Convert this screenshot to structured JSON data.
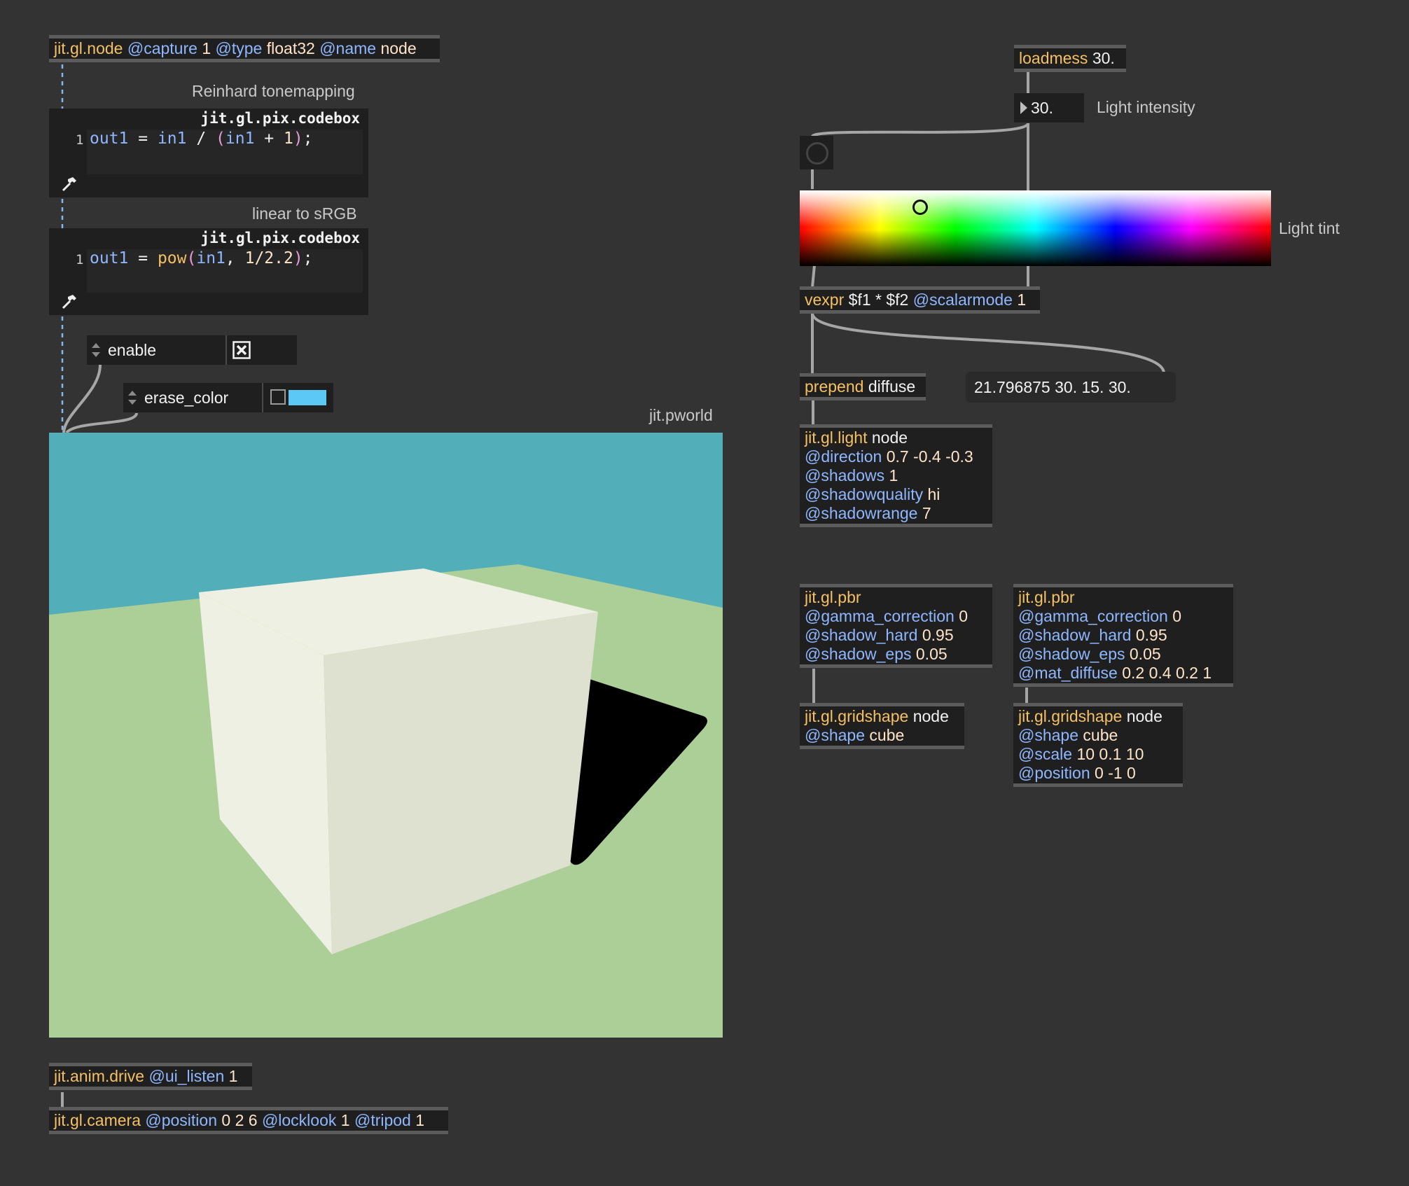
{
  "objects": {
    "gl_node": {
      "cls": "jit.gl.node",
      "a1": "@capture",
      "v1": "1",
      "a2": "@type",
      "v2": "float32",
      "a3": "@name",
      "v3": "node"
    },
    "anim_drive": {
      "cls": "jit.anim.drive",
      "a1": "@ui_listen",
      "v1": "1"
    },
    "camera": {
      "cls": "jit.gl.camera",
      "a1": "@position",
      "v1": "0 2 6",
      "a2": "@locklook",
      "v2": "1",
      "a3": "@tripod",
      "v3": "1"
    },
    "loadmess": {
      "cls": "loadmess",
      "v1": "30."
    },
    "vexpr": {
      "cls": "vexpr",
      "v1": "$f1 * $f2",
      "a1": "@scalarmode",
      "v2": "1"
    },
    "prepend": {
      "cls": "prepend",
      "v1": "diffuse"
    },
    "light": {
      "cls": "jit.gl.light",
      "v0": "node",
      "a1": "@direction",
      "v1": "0.7 -0.4 -0.3",
      "a2": "@shadows",
      "v2": "1",
      "a3": "@shadowquality",
      "v3": "hi",
      "a4": "@shadowrange",
      "v4": "7"
    },
    "pbr1": {
      "cls": "jit.gl.pbr",
      "a1": "@gamma_correction",
      "v1": "0",
      "a2": "@shadow_hard",
      "v2": "0.95",
      "a3": "@shadow_eps",
      "v3": "0.05"
    },
    "pbr2": {
      "cls": "jit.gl.pbr",
      "a1": "@gamma_correction",
      "v1": "0",
      "a2": "@shadow_hard",
      "v2": "0.95",
      "a3": "@shadow_eps",
      "v3": "0.05",
      "a4": "@mat_diffuse",
      "v4": "0.2 0.4 0.2 1"
    },
    "grid1": {
      "cls": "jit.gl.gridshape",
      "v0": "node",
      "a1": "@shape",
      "v1": "cube"
    },
    "grid2": {
      "cls": "jit.gl.gridshape",
      "v0": "node",
      "a1": "@shape",
      "v1": "cube",
      "a2": "@scale",
      "v2": "10 0.1 10",
      "a3": "@position",
      "v3": "0 -1 0"
    }
  },
  "codeboxes": {
    "tonemap": {
      "comment": "Reinhard tonemapping",
      "title": "jit.gl.pix.codebox",
      "line": "1",
      "t1": "out1",
      "t2": " = ",
      "t3": "in1",
      "t4": " / ",
      "t5": "(",
      "t6": "in1",
      "t7": " + ",
      "t8": "1",
      "t9": ")",
      "t10": ";"
    },
    "srgb": {
      "comment": "linear to sRGB",
      "title": "jit.gl.pix.codebox",
      "line": "1",
      "t1": "out1",
      "t2": " = ",
      "t3": "pow",
      "t4": "(",
      "t5": "in1",
      "t6": ", ",
      "t7": "1/2.2",
      "t8": ")",
      "t9": ";"
    }
  },
  "ui": {
    "enable": {
      "label": "enable",
      "checked": true
    },
    "erase_color": {
      "label": "erase_color",
      "swatch": "#5bc8f5"
    },
    "pworld_label": "jit.pworld",
    "intensity": {
      "value": "30.",
      "label": "Light intensity"
    },
    "tint_label": "Light tint",
    "message": "21.796875 30. 15. 30."
  },
  "colors": {
    "sky": "#52aeb8",
    "floor": "#accf98",
    "cube_light": "#eef0e3",
    "cube_front": "#dee1cf",
    "shadow": "#000000",
    "patchcord": "#a6a6a6",
    "dashcord": "#86b8ee"
  }
}
